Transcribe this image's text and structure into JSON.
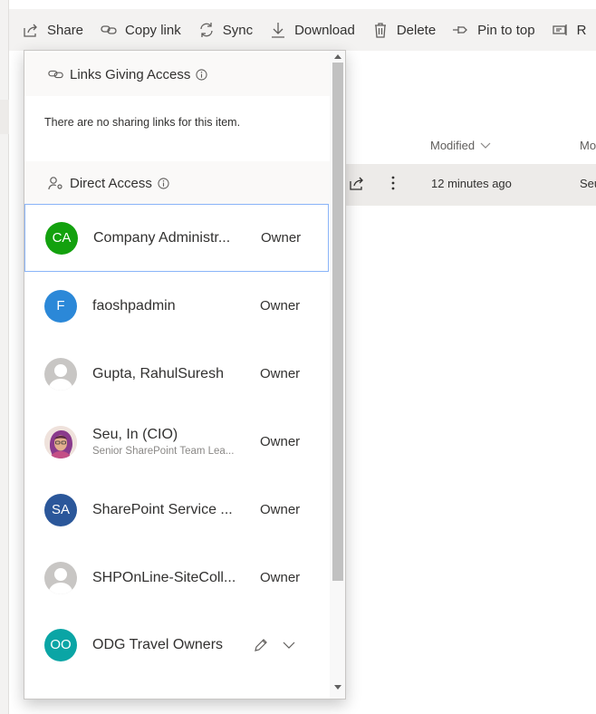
{
  "toolbar": {
    "share": "Share",
    "copy_link": "Copy link",
    "sync": "Sync",
    "download": "Download",
    "delete": "Delete",
    "pin_to_top": "Pin to top",
    "truncated": "R"
  },
  "list": {
    "modified_header": "Modified",
    "modified_by_header": "Mo",
    "row": {
      "modified": "12 minutes ago",
      "modified_by": "Seu"
    }
  },
  "panel": {
    "links_title": "Links Giving Access",
    "no_links_text": "There are no sharing links for this item.",
    "direct_title": "Direct Access",
    "people": [
      {
        "initials": "CA",
        "name": "Company Administr...",
        "subtitle": "",
        "role": "Owner",
        "color": "#13a10e"
      },
      {
        "initials": "F",
        "name": "faoshpadmin",
        "subtitle": "",
        "role": "Owner",
        "color": "#2b88d8"
      },
      {
        "initials": "",
        "name": "Gupta, RahulSuresh",
        "subtitle": "",
        "role": "Owner",
        "color": "#c8c6c4"
      },
      {
        "initials": "",
        "name": "Seu, In (CIO)",
        "subtitle": "Senior SharePoint Team Lea...",
        "role": "Owner",
        "color": "#a86a4a"
      },
      {
        "initials": "SA",
        "name": "SharePoint Service ...",
        "subtitle": "",
        "role": "Owner",
        "color": "#2b579a"
      },
      {
        "initials": "",
        "name": "SHPOnLine-SiteColl...",
        "subtitle": "",
        "role": "Owner",
        "color": "#c8c6c4"
      },
      {
        "initials": "OO",
        "name": "ODG Travel Owners",
        "subtitle": "",
        "role": "",
        "color": "#0aa5a5"
      }
    ]
  }
}
